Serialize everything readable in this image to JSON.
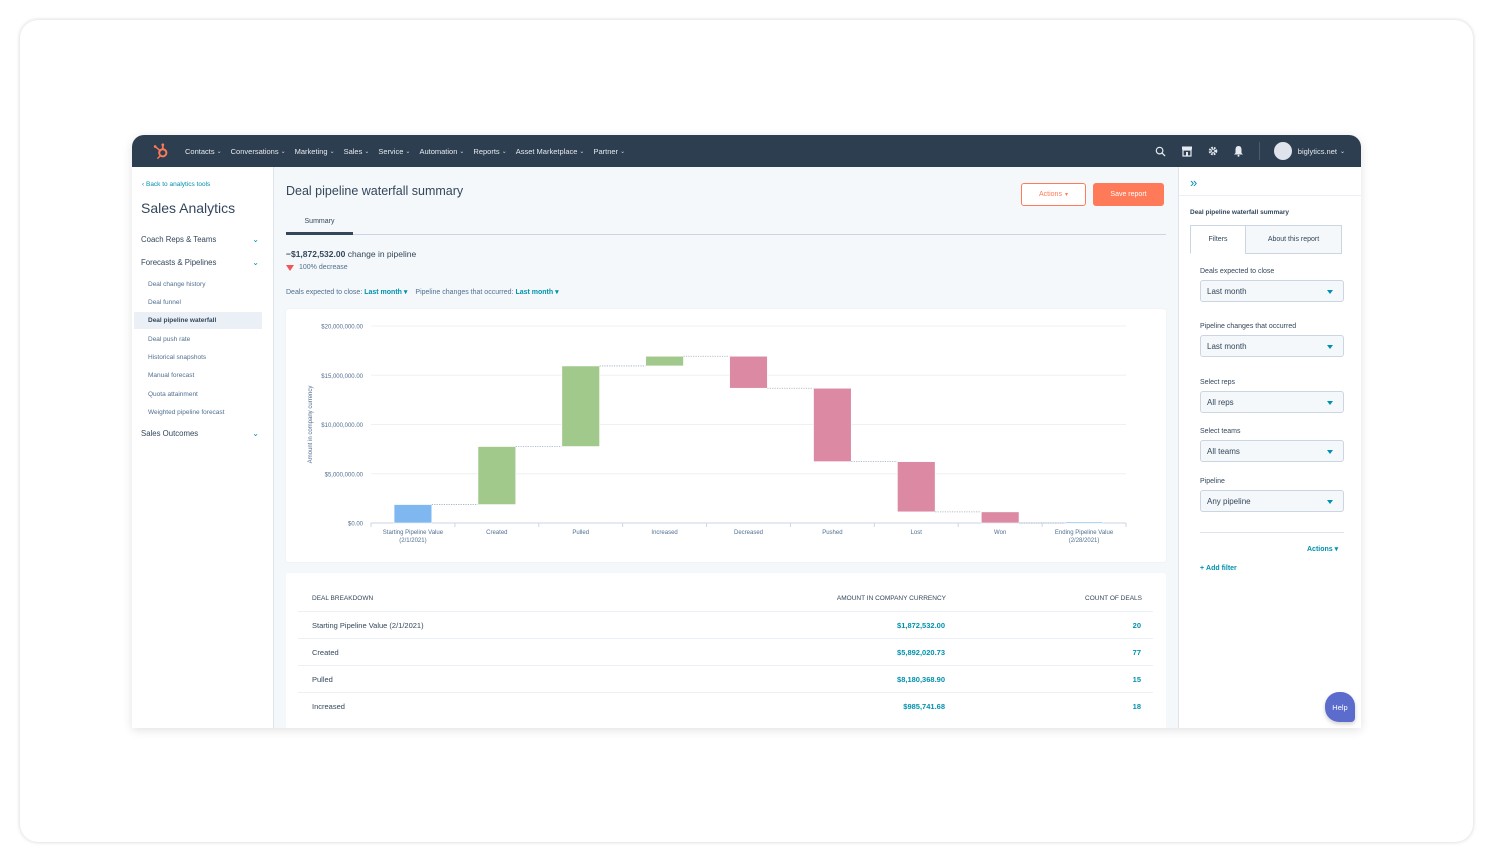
{
  "nav": {
    "items": [
      "Contacts",
      "Conversations",
      "Marketing",
      "Sales",
      "Service",
      "Automation",
      "Reports",
      "Asset Marketplace",
      "Partner"
    ],
    "account": "biglytics.net",
    "icons": [
      "search-icon",
      "marketplace-icon",
      "gear-icon",
      "bell-icon"
    ]
  },
  "sidebar": {
    "back_link": "Back to analytics tools",
    "title": "Sales Analytics",
    "groups": [
      {
        "label": "Coach Reps & Teams"
      },
      {
        "label": "Forecasts & Pipelines"
      },
      {
        "label": "Sales Outcomes"
      }
    ],
    "items": [
      {
        "label": "Deal change history"
      },
      {
        "label": "Deal funnel"
      },
      {
        "label": "Deal pipeline waterfall",
        "active": true
      },
      {
        "label": "Deal push rate"
      },
      {
        "label": "Historical snapshots"
      },
      {
        "label": "Manual forecast"
      },
      {
        "label": "Quota attainment"
      },
      {
        "label": "Weighted pipeline forecast"
      }
    ]
  },
  "main": {
    "title": "Deal pipeline waterfall summary",
    "actions_label": "Actions",
    "save_label": "Save report",
    "tab": "Summary",
    "change_value": "−$1,872,532.00",
    "change_suffix": "change in pipeline",
    "decrease_text": "100% decrease",
    "filter_close_label": "Deals expected to close:",
    "filter_close_value": "Last month",
    "filter_changes_label": "Pipeline changes that occurred:",
    "filter_changes_value": "Last month"
  },
  "chart_data": {
    "type": "bar",
    "subtype": "waterfall",
    "title": "",
    "xlabel": "",
    "ylabel": "Amount in company currency",
    "ylim": [
      0,
      20000000
    ],
    "yticks": [
      "$0.00",
      "$5,000,000.00",
      "$10,000,000.00",
      "$15,000,000.00",
      "$20,000,000.00"
    ],
    "ytick_values": [
      0,
      5000000,
      10000000,
      15000000,
      20000000
    ],
    "grid": true,
    "categories": [
      "Starting Pipeline Value (2/1/2021)",
      "Created",
      "Pulled",
      "Increased",
      "Decreased",
      "Pushed",
      "Lost",
      "Won",
      "Ending Pipeline Value (2/28/2021)"
    ],
    "category_lines": [
      [
        "Starting Pipeline Value",
        "(2/1/2021)"
      ],
      [
        "Created"
      ],
      [
        "Pulled"
      ],
      [
        "Increased"
      ],
      [
        "Decreased"
      ],
      [
        "Pushed"
      ],
      [
        "Lost"
      ],
      [
        "Won"
      ],
      [
        "Ending Pipeline Value",
        "(2/28/2021)"
      ]
    ],
    "values": [
      1872532.0,
      5892020.73,
      8180368.9,
      985741.68,
      -3250000,
      -7450000,
      -5100000,
      -1130000,
      0
    ],
    "kinds": [
      "total",
      "increase",
      "increase",
      "increase",
      "decrease",
      "decrease",
      "decrease",
      "decrease",
      "total"
    ],
    "colors": {
      "total": "#7fb8f0",
      "increase": "#a2c98c",
      "decrease": "#dc8aa4"
    }
  },
  "table": {
    "headers": [
      "DEAL BREAKDOWN",
      "AMOUNT IN COMPANY CURRENCY",
      "COUNT OF DEALS"
    ],
    "rows": [
      {
        "label": "Starting Pipeline Value (2/1/2021)",
        "amount": "$1,872,532.00",
        "count": "20"
      },
      {
        "label": "Created",
        "amount": "$5,892,020.73",
        "count": "77"
      },
      {
        "label": "Pulled",
        "amount": "$8,180,368.90",
        "count": "15"
      },
      {
        "label": "Increased",
        "amount": "$985,741.68",
        "count": "18"
      }
    ]
  },
  "rpanel": {
    "title": "Deal pipeline waterfall summary",
    "tabs": [
      "Filters",
      "About this report"
    ],
    "filters": [
      {
        "label": "Deals expected to close",
        "value": "Last month"
      },
      {
        "label": "Pipeline changes that occurred",
        "value": "Last month"
      },
      {
        "label": "Select reps",
        "value": "All reps"
      },
      {
        "label": "Select teams",
        "value": "All teams"
      },
      {
        "label": "Pipeline",
        "value": "Any pipeline"
      }
    ],
    "actions_label": "Actions",
    "add_filter_label": "Add filter"
  },
  "help_label": "Help"
}
